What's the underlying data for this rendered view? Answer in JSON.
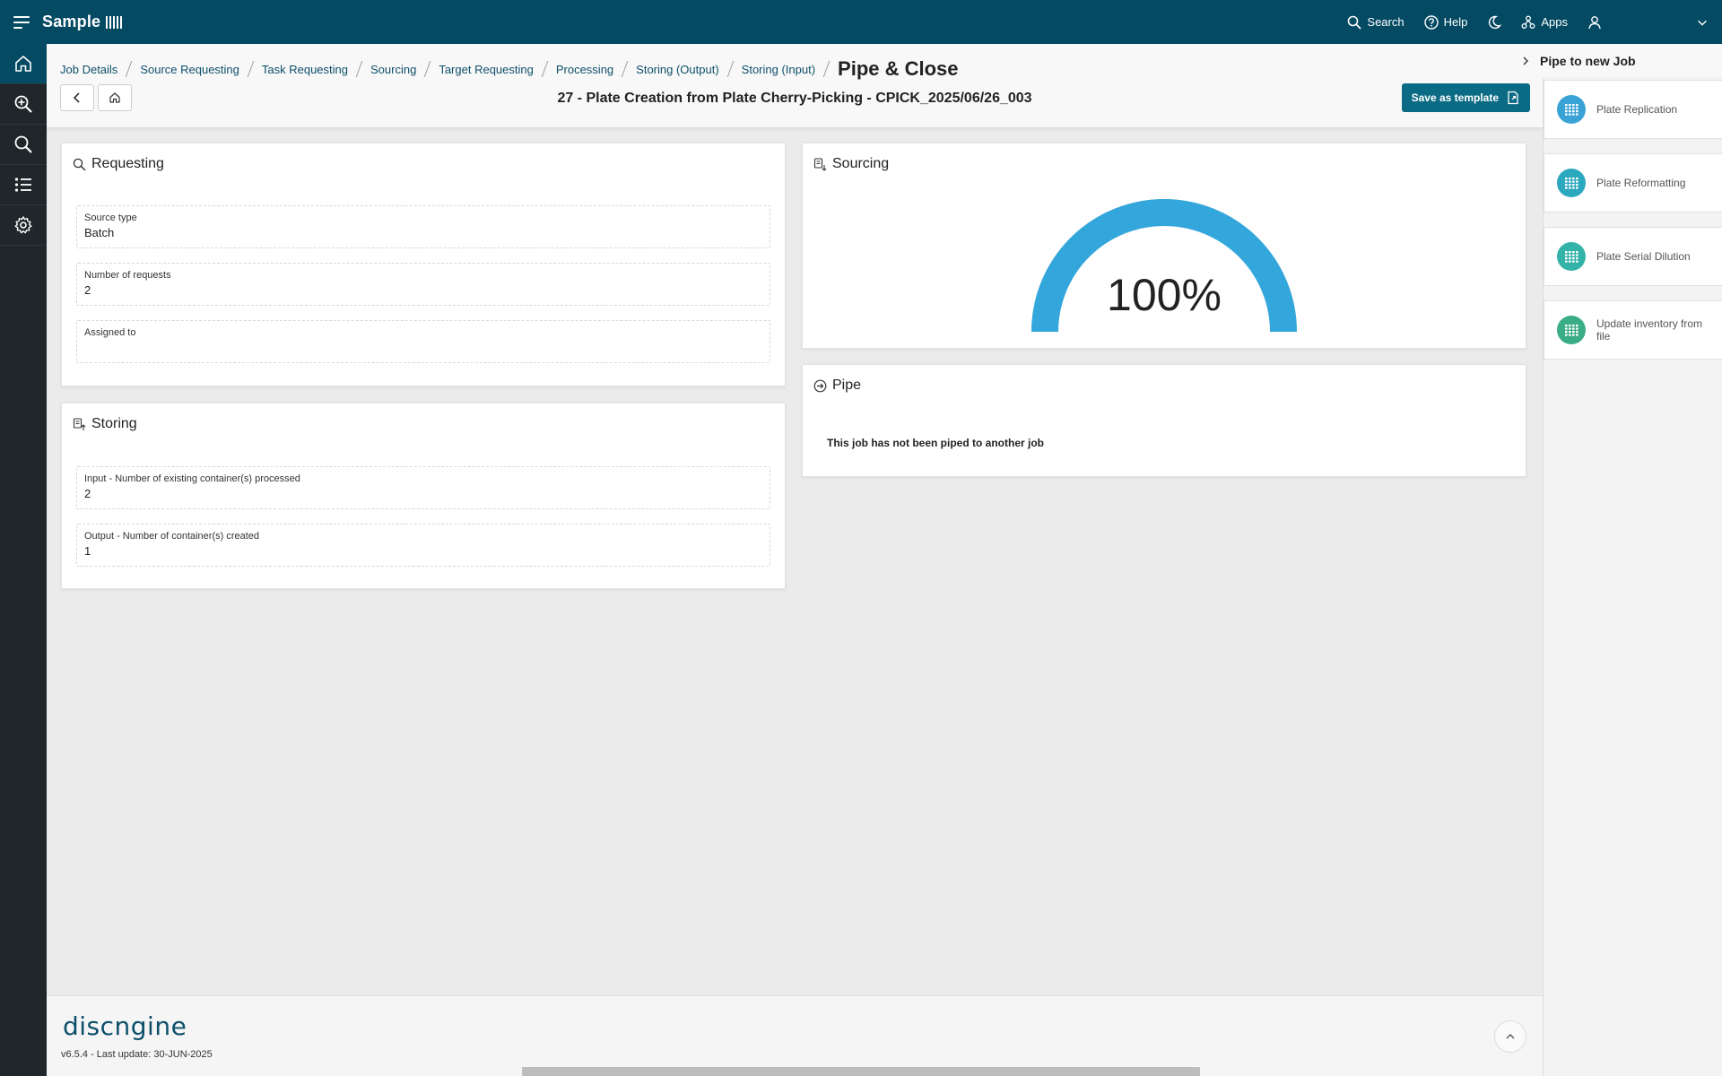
{
  "topbar": {
    "app_name": "Sample",
    "search_label": "Search",
    "help_label": "Help",
    "apps_label": "Apps"
  },
  "breadcrumb": {
    "items": [
      "Job Details",
      "Source Requesting",
      "Task Requesting",
      "Sourcing",
      "Target Requesting",
      "Processing",
      "Storing (Output)",
      "Storing (Input)"
    ],
    "current": "Pipe & Close"
  },
  "job_title": "27 - Plate Creation from Plate Cherry-Picking - CPICK_2025/06/26_003",
  "save_template_label": "Save as template",
  "requesting": {
    "title": "Requesting",
    "fields": [
      {
        "label": "Source type",
        "value": "Batch"
      },
      {
        "label": "Number of requests",
        "value": "2"
      },
      {
        "label": "Assigned to",
        "value": ""
      }
    ]
  },
  "storing": {
    "title": "Storing",
    "fields": [
      {
        "label": "Input - Number of existing container(s) processed",
        "value": "2"
      },
      {
        "label": "Output - Number of container(s) created",
        "value": "1"
      }
    ]
  },
  "sourcing": {
    "title": "Sourcing",
    "progress": 1.0,
    "progress_label": "100%",
    "gauge_color": "#33a6dc"
  },
  "pipe": {
    "title": "Pipe",
    "message": "This job has not been piped to another job"
  },
  "right_panel": {
    "title": "Pipe to new Job",
    "items": [
      {
        "label": "Plate Replication",
        "color": "#3aa3d6",
        "icon": "grid-icon"
      },
      {
        "label": "Plate Reformatting",
        "color": "#2ba7be",
        "icon": "grid-icon"
      },
      {
        "label": "Plate Serial Dilution",
        "color": "#33b3a8",
        "icon": "grid-icon"
      },
      {
        "label": "Update inventory from file",
        "color": "#3aac86",
        "icon": "grid-icon"
      }
    ]
  },
  "footer": {
    "logo_text": "discngine",
    "version": "v6.5.4 - Last update: 30-JUN-2025"
  },
  "colors": {
    "topbar": "#044a63",
    "sidebar": "#1f272b",
    "accent": "#0b6a84"
  }
}
